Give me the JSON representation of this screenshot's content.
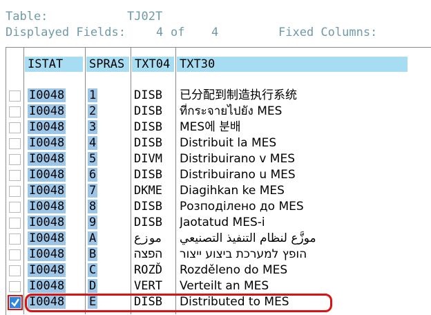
{
  "header": {
    "table_label": "Table:",
    "table_name": "TJ02T",
    "displayed_fields_label": "Displayed Fields:",
    "displayed_count": "4",
    "of_label": "of",
    "total_count": "4",
    "fixed_columns_label": "Fixed Columns:"
  },
  "columns": [
    "ISTAT",
    "SPRAS",
    "TXT04",
    "TXT30"
  ],
  "rows": [
    {
      "istat": "I0048",
      "spras": "1",
      "txt04": "DISB",
      "txt30": "已分配到制造执行系统",
      "checked": false
    },
    {
      "istat": "I0048",
      "spras": "2",
      "txt04": "DISB",
      "txt30": "ที่กระจายไปยัง MES",
      "checked": false
    },
    {
      "istat": "I0048",
      "spras": "3",
      "txt04": "DISB",
      "txt30": "MES에 분배",
      "checked": false
    },
    {
      "istat": "I0048",
      "spras": "4",
      "txt04": "DISB",
      "txt30": "Distribuit la MES",
      "checked": false
    },
    {
      "istat": "I0048",
      "spras": "5",
      "txt04": "DIVM",
      "txt30": "Distribuirano v MES",
      "checked": false
    },
    {
      "istat": "I0048",
      "spras": "6",
      "txt04": "DISB",
      "txt30": "Distribuirano u MES",
      "checked": false
    },
    {
      "istat": "I0048",
      "spras": "7",
      "txt04": "DKME",
      "txt30": "Diagihkan ke MES",
      "checked": false
    },
    {
      "istat": "I0048",
      "spras": "8",
      "txt04": "DISB",
      "txt30": "Розподілено до MES",
      "checked": false
    },
    {
      "istat": "I0048",
      "spras": "9",
      "txt04": "DISB",
      "txt30": "Jaotatud MES-i",
      "checked": false
    },
    {
      "istat": "I0048",
      "spras": "A",
      "txt04": "موزع",
      "txt30": "موزَّع لنظام التنفيذ التصنيعي",
      "checked": false
    },
    {
      "istat": "I0048",
      "spras": "B",
      "txt04": "הפצה",
      "txt30": "הופץ למערכת ביצוע ייצור",
      "checked": false
    },
    {
      "istat": "I0048",
      "spras": "C",
      "txt04": "ROZĎ",
      "txt30": "Rozděleno do MES",
      "checked": false
    },
    {
      "istat": "I0048",
      "spras": "D",
      "txt04": "VERT",
      "txt30": "Verteilt an MES",
      "checked": false
    },
    {
      "istat": "I0048",
      "spras": "E",
      "txt04": "DISB",
      "txt30": "Distributed to MES",
      "checked": true
    }
  ],
  "colors": {
    "header_text": "#6e9aa6",
    "column_header_bg": "#a7ddf2",
    "key_bg": "#9cc6e8",
    "highlight": "#dd1111"
  }
}
